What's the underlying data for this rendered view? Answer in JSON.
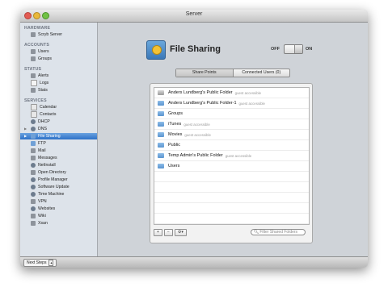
{
  "window": {
    "title": "Server"
  },
  "sidebar": {
    "sections": [
      {
        "header": "HARDWARE",
        "items": [
          {
            "label": "Scryb Server",
            "icon": "server-icon"
          }
        ]
      },
      {
        "header": "ACCOUNTS",
        "items": [
          {
            "label": "Users",
            "icon": "user-icon"
          },
          {
            "label": "Groups",
            "icon": "group-icon"
          }
        ]
      },
      {
        "header": "STATUS",
        "items": [
          {
            "label": "Alerts",
            "icon": "alert-icon"
          },
          {
            "label": "Logs",
            "icon": "log-icon"
          },
          {
            "label": "Stats",
            "icon": "stats-icon"
          }
        ]
      },
      {
        "header": "SERVICES",
        "items": [
          {
            "label": "Calendar",
            "icon": "calendar-icon"
          },
          {
            "label": "Contacts",
            "icon": "contacts-icon"
          },
          {
            "label": "DHCP",
            "icon": "dhcp-icon"
          },
          {
            "label": "DNS",
            "icon": "globe-icon"
          },
          {
            "label": "File Sharing",
            "icon": "file-sharing-icon",
            "selected": true
          },
          {
            "label": "FTP",
            "icon": "ftp-icon"
          },
          {
            "label": "Mail",
            "icon": "mail-icon"
          },
          {
            "label": "Messages",
            "icon": "messages-icon"
          },
          {
            "label": "NetInstall",
            "icon": "netinstall-icon"
          },
          {
            "label": "Open Directory",
            "icon": "directory-icon"
          },
          {
            "label": "Profile Manager",
            "icon": "profile-icon"
          },
          {
            "label": "Software Update",
            "icon": "update-icon"
          },
          {
            "label": "Time Machine",
            "icon": "time-machine-icon"
          },
          {
            "label": "VPN",
            "icon": "vpn-icon"
          },
          {
            "label": "Websites",
            "icon": "websites-icon"
          },
          {
            "label": "Wiki",
            "icon": "wiki-icon"
          },
          {
            "label": "Xsan",
            "icon": "xsan-icon"
          }
        ]
      }
    ]
  },
  "header": {
    "title": "File Sharing",
    "off_label": "OFF",
    "on_label": "ON"
  },
  "tabs": [
    {
      "label": "Share Points",
      "active": true
    },
    {
      "label": "Connected Users (0)",
      "active": false
    }
  ],
  "shared_folders": [
    {
      "name": "Anders Lundberg's Public Folder",
      "note": "guest accessible",
      "icon": "disk-icon"
    },
    {
      "name": "Anders Lundberg's Public Folder-1",
      "note": "guest accessible",
      "icon": "folder-icon"
    },
    {
      "name": "Groups",
      "note": "",
      "icon": "folder-icon"
    },
    {
      "name": "iTunes",
      "note": "guest accessible",
      "icon": "folder-icon"
    },
    {
      "name": "Movies",
      "note": "guest accessible",
      "icon": "folder-icon"
    },
    {
      "name": "Public",
      "note": "",
      "icon": "folder-icon"
    },
    {
      "name": "Temp Admin's Public Folder",
      "note": "guest accessible",
      "icon": "folder-icon"
    },
    {
      "name": "Users",
      "note": "",
      "icon": "folder-icon"
    }
  ],
  "panel_buttons": {
    "add": "+",
    "remove": "−",
    "action": "⚙▾"
  },
  "search": {
    "placeholder": "Filter Shared Folders"
  },
  "bottom": {
    "next_steps": "Next Steps"
  }
}
